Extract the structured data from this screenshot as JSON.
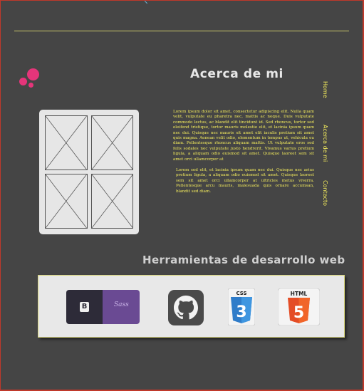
{
  "about": {
    "title": "Acerca de mi",
    "paragraph1": "Lorem ipsum dolor sit amet, consectetur adipiscing elit. Nulla quam velit, vulputate eu pharetra nec, mattis ac neque. Duis vulputate commodo lectus, ac blandit elit tincidunt id. Sed rhoncus, tortor sed eleifend tristique, tortor mauris molestie elit, et lacinia ipsum quam nec dui. Quisque nec mauris sit amet elit iaculis pretium sit amet quis magna. Aenean velit odio, elementum in tempus ut, vehicula eu diam. Pellentesque rhoncus aliquam mattis. Ut vulputate eros sed felis sodales nec vulputate justo hendrerit. Vivamus varius pretium ligula, a aliquam odio euismod sit amet. Quisque laoreet sem sit amet orci ullamcorper at",
    "paragraph2": "Lorem sed elit, et lacinia ipsum quam nec dui. Quisque nec arius pretium ligula, a aliquam odio euismod sit amet. Quisque laoreet sem sit amet orci ullamcorper at ultricies metus viverra. Pellentesque arcu mauris, malesuada quis ornare accumsan, blandit sed diam."
  },
  "nav": {
    "items": [
      {
        "label": "Home"
      },
      {
        "label": "Acerca de mi"
      },
      {
        "label": "Contacto"
      }
    ]
  },
  "tools": {
    "title": "Herramientas de desarrollo web",
    "bootstrap_letter": "B",
    "sass_text": "Sass",
    "css_label": "CSS",
    "css_number": "3",
    "html_label": "HTML",
    "html_number": "5"
  },
  "colors": {
    "background": "#454545",
    "accent_yellow": "#f2ea5c",
    "logo_pink": "#e5357a",
    "css_blue": "#2f7cc9",
    "html_orange": "#e44d26"
  }
}
